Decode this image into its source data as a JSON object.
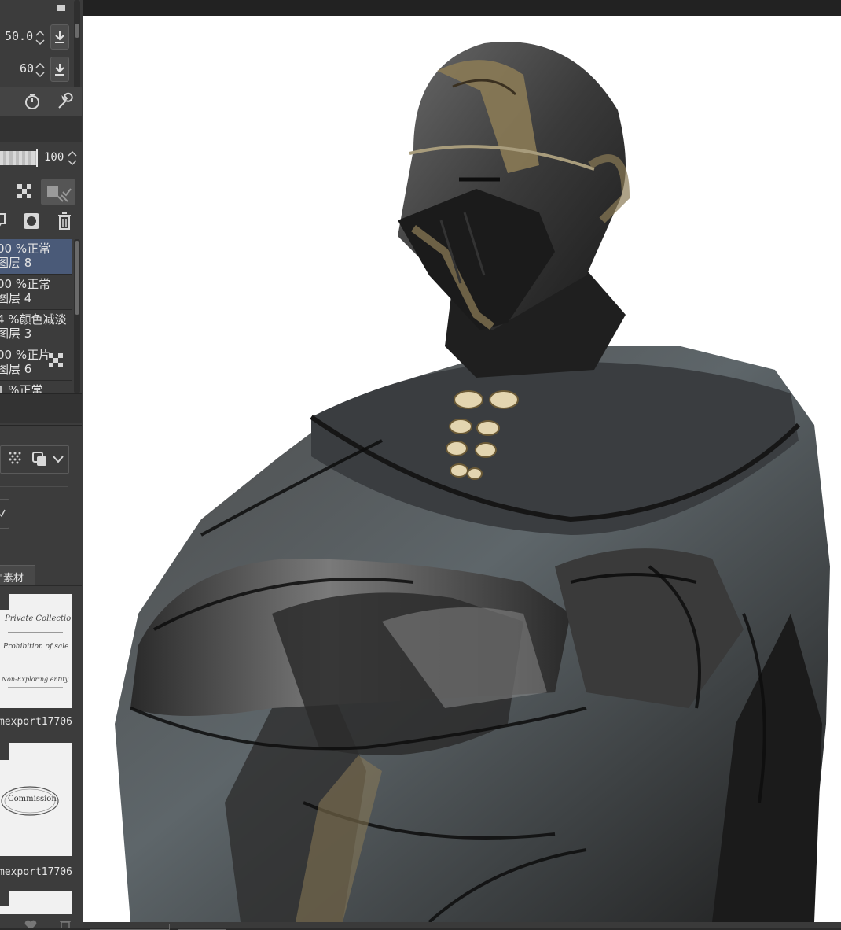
{
  "tool_property": {
    "size_value": "50.0",
    "density_value": "60"
  },
  "layer_panel": {
    "opacity_value": "100",
    "layers": [
      {
        "line1": "00 %正常",
        "line2": "图层 8",
        "selected": true
      },
      {
        "line1": "00 %正常",
        "line2": "图层 4",
        "selected": false
      },
      {
        "line1": "4 %颜色减淡",
        "line2": "图层 3",
        "selected": false
      },
      {
        "line1": "00 %正片",
        "line2": "图层 6",
        "selected": false
      },
      {
        "line1": "1 %正常",
        "line2": "",
        "selected": false
      }
    ]
  },
  "material_panel": {
    "tab_label": "\"素材",
    "items": [
      {
        "label": "mexport17706",
        "thumb_text": [
          "Private Collection",
          "Prohibition of sale",
          "Non-Exploring entity"
        ]
      },
      {
        "label": "mexport17706",
        "thumb_text": [
          "Commission"
        ]
      }
    ]
  },
  "colors": {
    "panel_bg": "#3c3c3c",
    "selected_layer": "#4a5a78",
    "canvas_bg": "#ffffff",
    "armor_dark": "#2a2a2a",
    "armor_gold": "#8a7a55"
  },
  "icons": [
    "chevron-spin-icon",
    "download-icon",
    "stopwatch-icon",
    "wrench-icon",
    "checker-icon",
    "reference-off-icon",
    "new-layer-icon",
    "mask-icon",
    "trash-icon",
    "dither-icon",
    "copy-icon",
    "chevron-down-icon",
    "heart-icon"
  ]
}
